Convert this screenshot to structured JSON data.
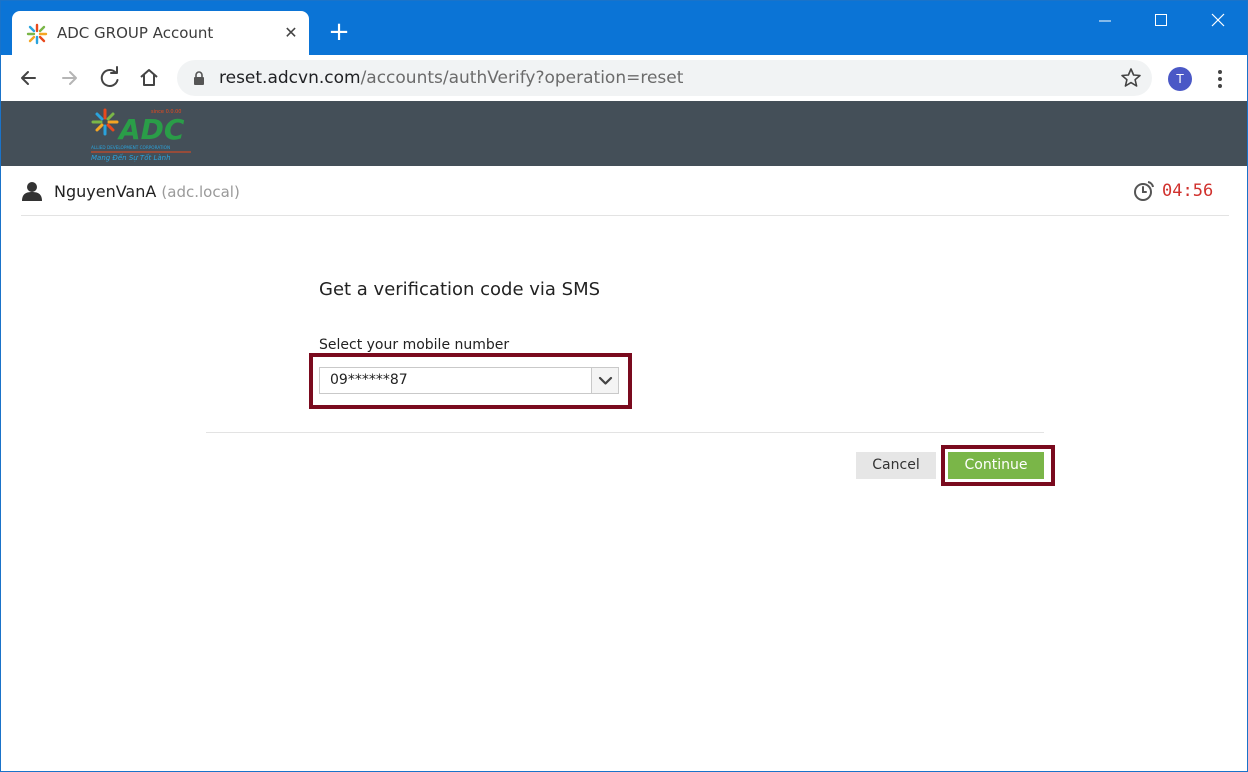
{
  "browser": {
    "tab_title": "ADC GROUP Account",
    "tab_close": "✕",
    "new_tab": "+",
    "url_host": "reset.adcvn.com",
    "url_path": "/accounts/authVerify?operation=reset",
    "profile_initial": "T"
  },
  "site": {
    "logo_text": "ADC",
    "logo_since": "since 0.0.00",
    "logo_company": "ALLIED DEVELOPMENT CORPORATION",
    "logo_slogan": "Mang Đến Sự Tốt Lành",
    "header_color": "#444f58"
  },
  "user": {
    "name": "NguyenVanA",
    "domain": "(adc.local)",
    "countdown": "04:56"
  },
  "form": {
    "title": "Get a verification code via SMS",
    "mobile_label": "Select your mobile number",
    "mobile_selected": "09******87",
    "cancel_label": "Cancel",
    "continue_label": "Continue"
  },
  "colors": {
    "accent_green": "#7ab648",
    "highlight_border": "#7a0a1e",
    "timer_red": "#d0312d",
    "chrome_blue": "#0b74d6"
  }
}
